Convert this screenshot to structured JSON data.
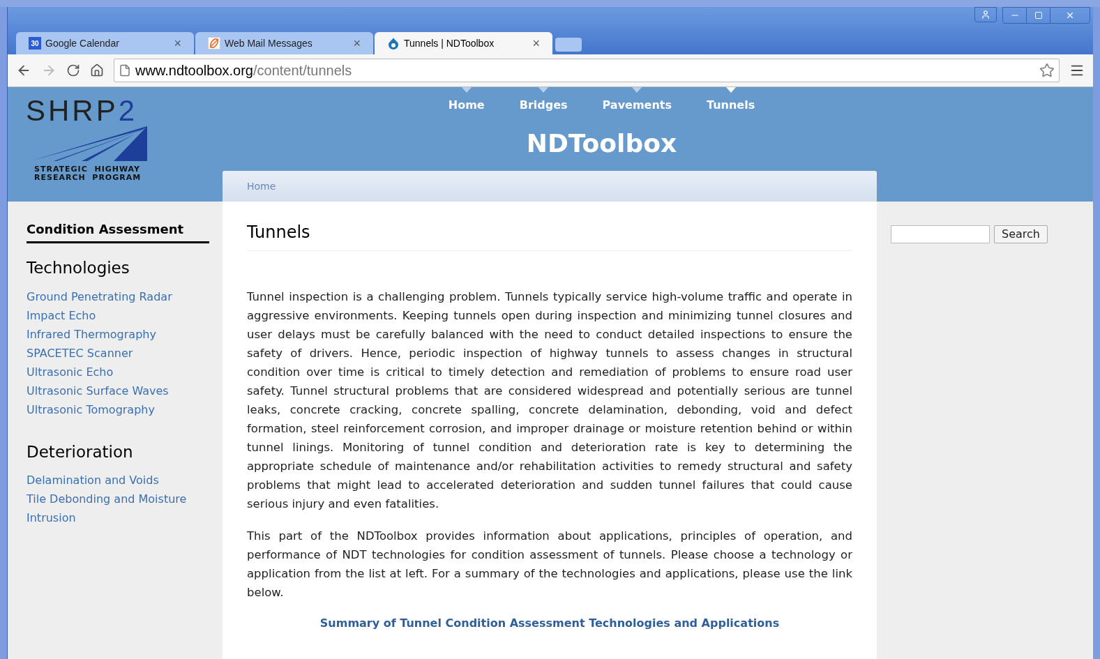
{
  "browser": {
    "tabs": [
      {
        "label": "Google Calendar",
        "kind": "calendar",
        "icon_text": "30",
        "selected": false
      },
      {
        "label": "Web Mail Messages",
        "kind": "mail",
        "selected": false
      },
      {
        "label": "Tunnels | NDToolbox",
        "kind": "drop",
        "selected": true
      }
    ],
    "close_glyph": "×",
    "url_host": "www.ndtoolbox.org",
    "url_path": "/content/tunnels"
  },
  "site": {
    "logo_title": "SHRP",
    "logo_digit": "2",
    "logo_caption": [
      "STRATEGIC  HIGHWAY",
      "RESEARCH  PROGRAM"
    ],
    "nav": [
      {
        "label": "Home",
        "selected": false
      },
      {
        "label": "Bridges",
        "selected": false
      },
      {
        "label": "Pavements",
        "selected": false
      },
      {
        "label": "Tunnels",
        "selected": true
      }
    ],
    "site_name": "NDToolbox",
    "breadcrumb": "Home"
  },
  "sidebar": {
    "heading": "Condition Assessment",
    "sections": [
      {
        "title": "Technologies",
        "links": [
          "Ground Penetrating Radar",
          "Impact Echo",
          "Infrared Thermography",
          "SPACETEC Scanner",
          "Ultrasonic Echo",
          "Ultrasonic Surface Waves",
          "Ultrasonic Tomography"
        ]
      },
      {
        "title": "Deterioration",
        "links": [
          "Delamination and Voids",
          "Tile Debonding and Moisture Intrusion"
        ]
      }
    ]
  },
  "article": {
    "title": "Tunnels",
    "paragraphs": [
      "Tunnel inspection is a challenging problem. Tunnels typically service high-volume traffic and operate in aggressive environments. Keeping tunnels open during inspection and minimizing tunnel closures and user delays must be carefully balanced with the need to conduct detailed inspections to ensure the safety of drivers. Hence, periodic inspection of highway tunnels to assess changes in structural condition over time is critical to timely detection and remediation of problems to ensure road user safety. Tunnel structural problems that are considered widespread and potentially serious are tunnel leaks, concrete cracking, concrete spalling, concrete delamination, debonding, void and defect formation, steel reinforcement corrosion, and improper drainage or moisture retention behind or within tunnel linings. Monitoring of tunnel condition and deterioration rate is key to determining the appropriate schedule of maintenance and/or rehabilitation activities to remedy structural and safety problems that might lead to accelerated deterioration and sudden tunnel failures that could cause serious injury and even fatalities.",
      "This part of the NDToolbox provides information about applications, principles of operation, and performance of NDT technologies for condition assessment of tunnels. Please choose a technology or application from the list at left. For a summary of the technologies and applications, please use the link below."
    ],
    "link": "Summary of Tunnel Condition Assessment Technologies and Applications"
  },
  "search": {
    "button": "Search"
  }
}
